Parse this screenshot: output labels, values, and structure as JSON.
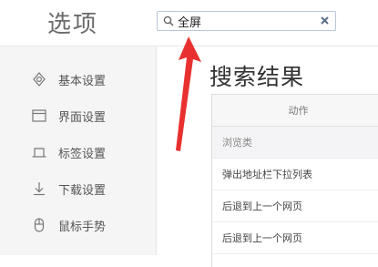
{
  "header": {
    "title": "选项",
    "search": {
      "value": "全屏",
      "placeholder": ""
    }
  },
  "sidebar": {
    "items": [
      {
        "label": "基本设置",
        "icon": "gear-icon"
      },
      {
        "label": "界面设置",
        "icon": "window-icon"
      },
      {
        "label": "标签设置",
        "icon": "tab-icon"
      },
      {
        "label": "下载设置",
        "icon": "download-icon"
      },
      {
        "label": "鼠标手势",
        "icon": "mouse-icon"
      }
    ]
  },
  "main": {
    "title": "搜索结果",
    "table": {
      "header": "动作",
      "rows": [
        {
          "text": "浏览类",
          "type": "category"
        },
        {
          "text": "弹出地址栏下拉列表",
          "type": "item"
        },
        {
          "text": "后退到上一个网页",
          "type": "item"
        },
        {
          "text": "后退到上一个网页",
          "type": "item"
        }
      ]
    }
  },
  "colors": {
    "annotation": "#e8312f",
    "search_border": "#b9c7da",
    "sidebar_bg": "#f5f5f5"
  }
}
